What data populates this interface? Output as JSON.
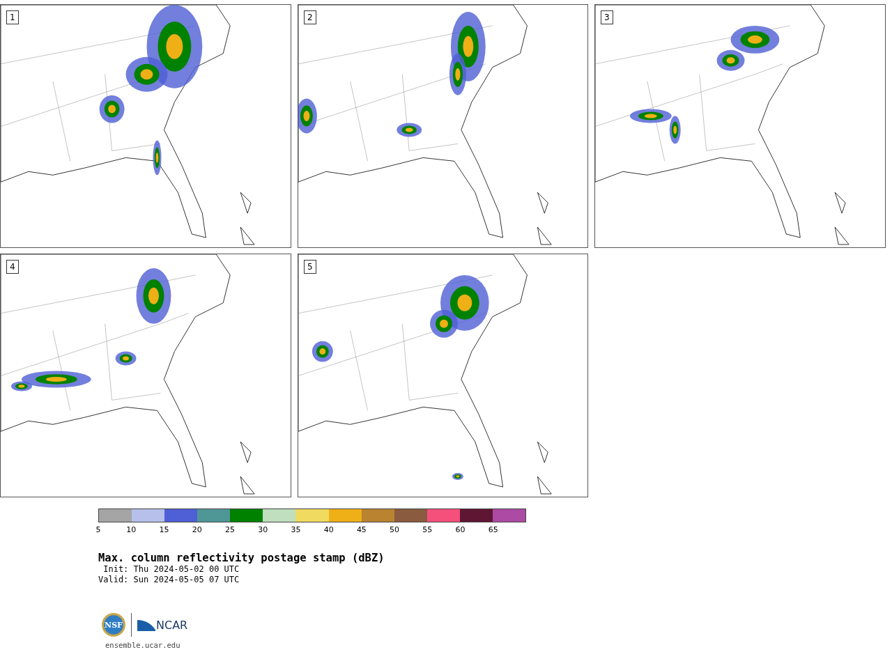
{
  "panels": [
    {
      "label": "1"
    },
    {
      "label": "2"
    },
    {
      "label": "3"
    },
    {
      "label": "4"
    },
    {
      "label": "5"
    }
  ],
  "colorbar": {
    "bins": [
      {
        "label": "5",
        "color": "#a5a5a5"
      },
      {
        "label": "10",
        "color": "#b6c0ea"
      },
      {
        "label": "15",
        "color": "#4f5fd5"
      },
      {
        "label": "20",
        "color": "#4f9697"
      },
      {
        "label": "25",
        "color": "#018100"
      },
      {
        "label": "30",
        "color": "#bfdfbf"
      },
      {
        "label": "35",
        "color": "#f0da60"
      },
      {
        "label": "40",
        "color": "#efaf17"
      },
      {
        "label": "45",
        "color": "#b98330"
      },
      {
        "label": "50",
        "color": "#8a5b3f"
      },
      {
        "label": "55",
        "color": "#f4507b"
      },
      {
        "label": "60",
        "color": "#5f1633"
      },
      {
        "label": "65",
        "color": "#ac4aa4"
      }
    ]
  },
  "title": "Max. column reflectivity postage stamp (dBZ)",
  "init": " Init: Thu 2024-05-02 00 UTC",
  "valid": "Valid: Sun 2024-05-05 07 UTC",
  "logos": {
    "left": "NSF",
    "right": "NCAR"
  },
  "url": "ensemble.ucar.edu"
}
